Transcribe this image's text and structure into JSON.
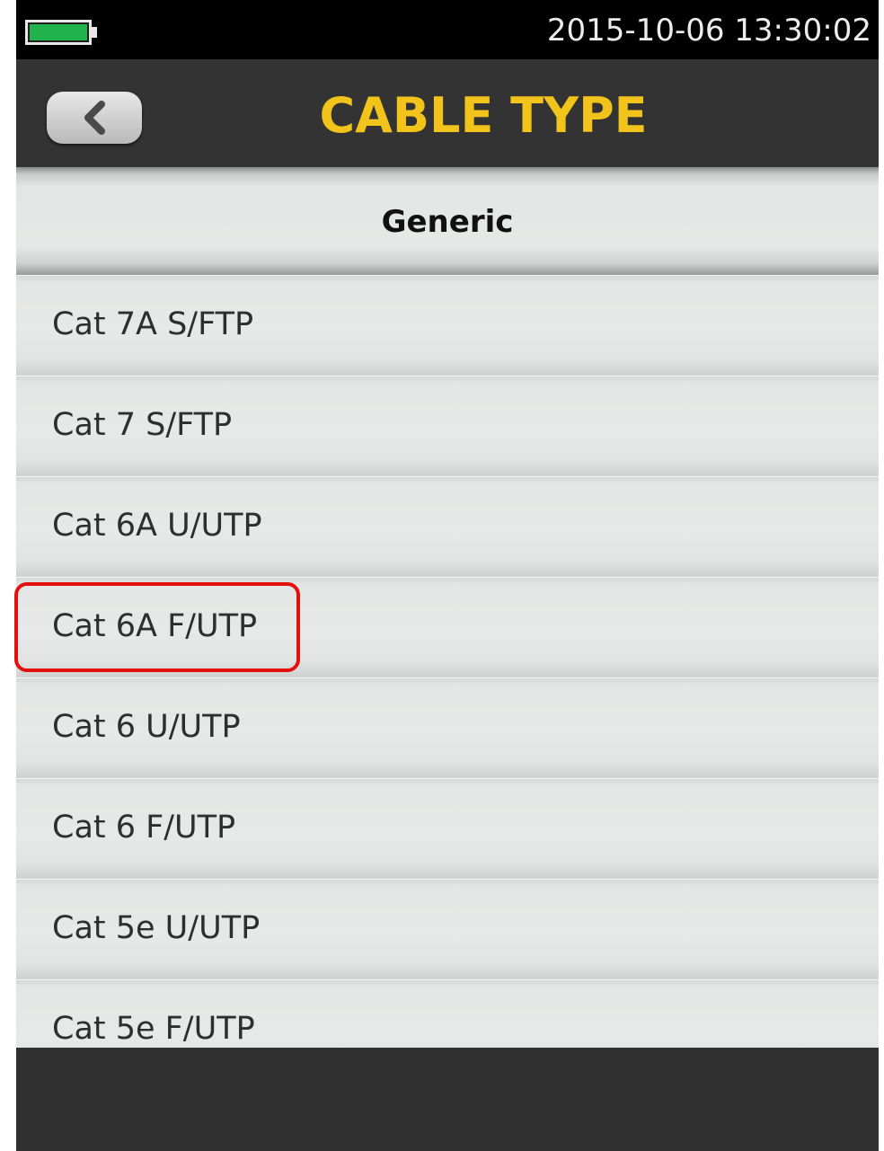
{
  "status_bar": {
    "datetime": "2015-10-06 13:30:02",
    "battery_color": "#22b24c"
  },
  "header": {
    "title": "CABLE TYPE",
    "title_color": "#f2c31a",
    "back_icon": "chevron-left-icon"
  },
  "section": {
    "title": "Generic"
  },
  "list": {
    "items": [
      {
        "label": "Cat 7A S/FTP"
      },
      {
        "label": "Cat 7 S/FTP"
      },
      {
        "label": "Cat 6A U/UTP"
      },
      {
        "label": "Cat 6A F/UTP",
        "highlighted": true
      },
      {
        "label": "Cat 6 U/UTP"
      },
      {
        "label": "Cat 6 F/UTP"
      },
      {
        "label": "Cat 5e U/UTP"
      },
      {
        "label": "Cat 5e F/UTP"
      }
    ]
  },
  "annotation": {
    "highlight_color": "#e3100f"
  }
}
